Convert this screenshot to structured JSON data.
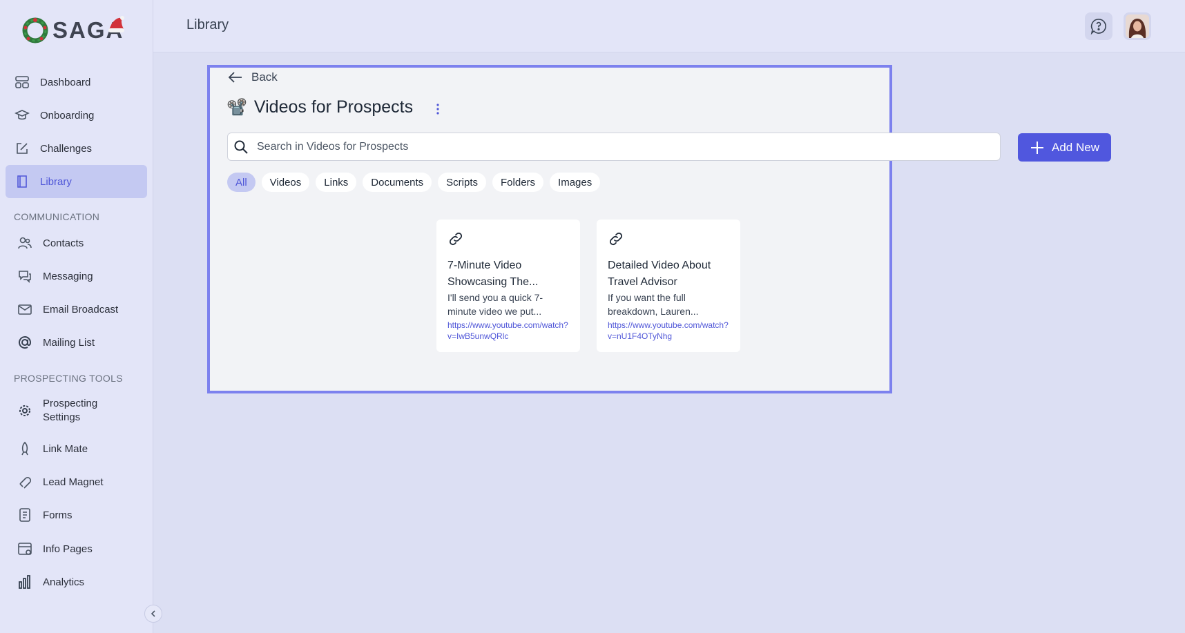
{
  "app": {
    "logo_text": "SAGA",
    "accent": "#5057de"
  },
  "header": {
    "title": "Library",
    "help_icon": "chat-question-icon",
    "avatar": "user-avatar"
  },
  "sidebar": {
    "items": [
      {
        "label": "Dashboard",
        "icon": "dashboard-icon"
      },
      {
        "label": "Onboarding",
        "icon": "graduation-cap-icon"
      },
      {
        "label": "Challenges",
        "icon": "edit-square-icon"
      },
      {
        "label": "Library",
        "icon": "book-icon",
        "active": true
      }
    ],
    "section_communication": "COMMUNICATION",
    "communication_items": [
      {
        "label": "Contacts",
        "icon": "users-icon"
      },
      {
        "label": "Messaging",
        "icon": "chat-bubbles-icon"
      },
      {
        "label": "Email Broadcast",
        "icon": "mail-icon"
      },
      {
        "label": "Mailing List",
        "icon": "at-sign-icon"
      }
    ],
    "section_prospecting": "PROSPECTING TOOLS",
    "prospecting_items": [
      {
        "label": "Prospecting Settings",
        "label_line1": "Prospecting",
        "label_line2": "Settings",
        "icon": "gear-icon"
      },
      {
        "label": "Link Mate",
        "icon": "rocket-icon"
      },
      {
        "label": "Lead Magnet",
        "icon": "magnet-icon"
      },
      {
        "label": "Forms",
        "icon": "form-icon"
      },
      {
        "label": "Info Pages",
        "icon": "info-page-icon"
      },
      {
        "label": "Analytics",
        "icon": "bar-chart-icon"
      }
    ]
  },
  "main": {
    "back_label": "Back",
    "folder_emoji": "📽️",
    "folder_title": "Videos for Prospects",
    "search_placeholder": "Search in Videos for Prospects",
    "add_new_label": "Add New",
    "filters": [
      "All",
      "Videos",
      "Links",
      "Documents",
      "Scripts",
      "Folders",
      "Images"
    ],
    "active_filter": "All",
    "cards": [
      {
        "icon": "link-icon",
        "title_line1": "7-Minute Video",
        "title_line2": "Showcasing The...",
        "desc_line1": "I'll send you a quick 7-",
        "desc_line2": "minute video we put...",
        "url": "https://www.youtube.com/watch?v=IwB5unwQRlc"
      },
      {
        "icon": "link-icon",
        "title_line1": "Detailed Video About",
        "title_line2": "Travel Advisor",
        "desc_line1": "If you want the full",
        "desc_line2": "breakdown, Lauren...",
        "url": "https://www.youtube.com/watch?v=nU1F4OTyNhg"
      }
    ]
  }
}
